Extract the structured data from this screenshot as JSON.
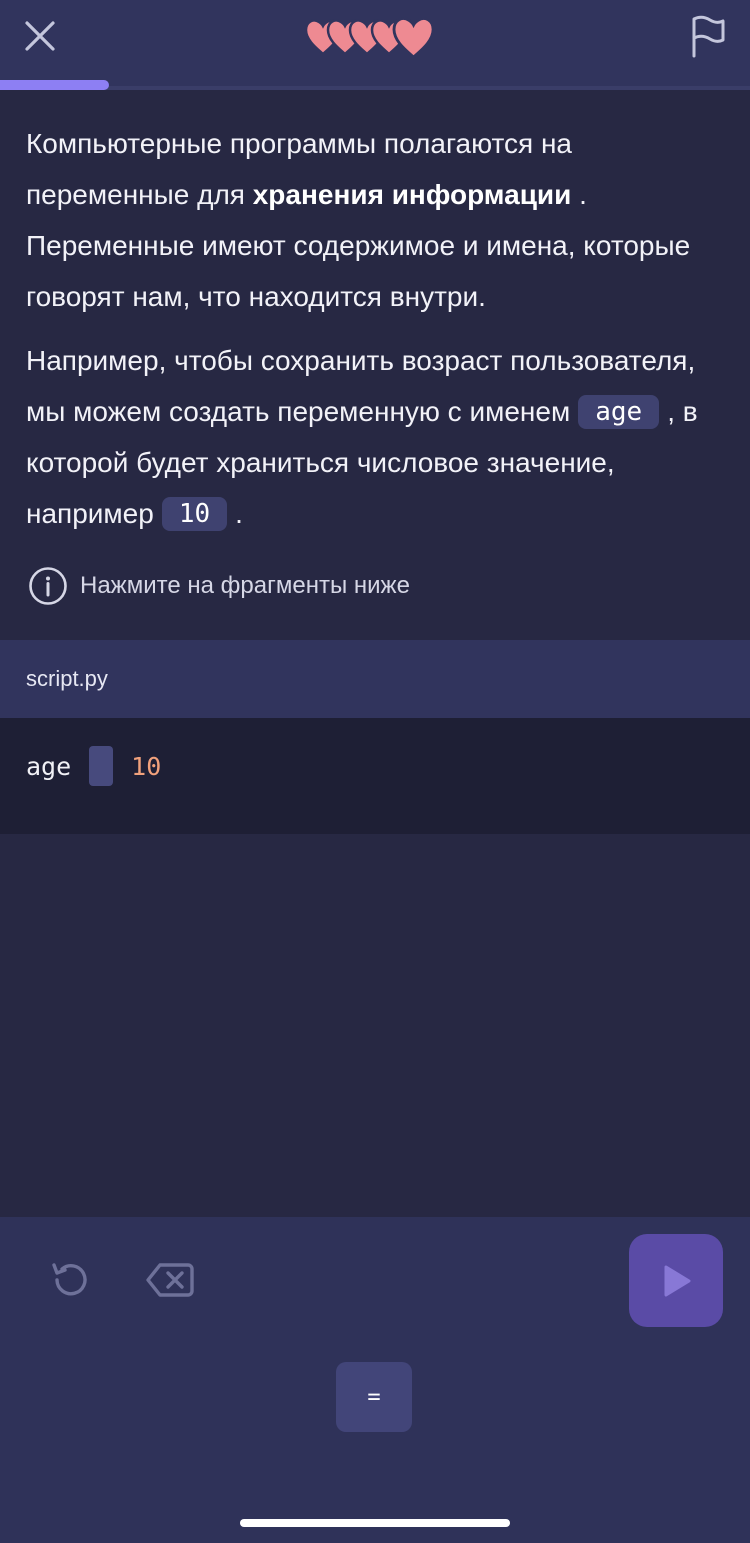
{
  "header": {
    "close_icon": "close-icon",
    "hearts_icon": "hearts-icon",
    "hearts_count": 5,
    "heart_color": "#ee8a92",
    "report_icon": "flag-icon",
    "progress": 0.145,
    "progress_color": "#8d7ff3"
  },
  "lesson": {
    "p1_before": "Компьютерные программы полагаются на переменные для ",
    "p1_bold": "хранения информации",
    "p1_after": " . Переменные имеют содержимое и имена, которые говорят нам, что находится внутри.",
    "p2_part1": "Например, чтобы сохранить возраст пользователя, мы можем создать переменную с именем",
    "chip_var": "age",
    "p2_part2": ", в которой будет храниться числовое значение, например",
    "chip_value": "10",
    "p2_end": "."
  },
  "hint": {
    "icon": "info-icon",
    "text": "Нажмите на фрагменты ниже"
  },
  "editor": {
    "file_name": "script.py",
    "var_name": "age",
    "value": "10",
    "value_color": "#f1a17c"
  },
  "controls": {
    "undo_icon": "undo-icon",
    "backspace_icon": "backspace-icon",
    "run_icon": "play-icon",
    "run_color": "#5a4ba6"
  },
  "tokens": [
    "="
  ]
}
